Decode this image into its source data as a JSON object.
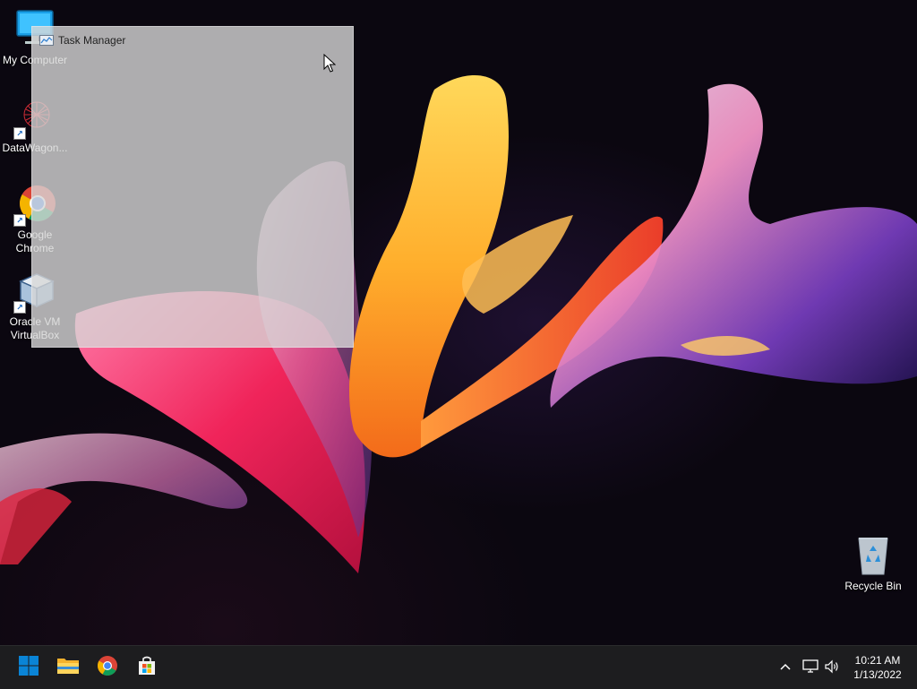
{
  "desktop": {
    "icons": [
      {
        "label": "My Computer",
        "icon": "monitor-icon"
      },
      {
        "label": "DataWagon...",
        "icon": "datawagon-icon"
      },
      {
        "label": "Google Chrome",
        "icon": "chrome-icon"
      },
      {
        "label": "Oracle VM VirtualBox",
        "icon": "virtualbox-icon"
      },
      {
        "label": "Recycle Bin",
        "icon": "recycle-bin-icon"
      }
    ]
  },
  "ghost_window": {
    "title": "Task Manager",
    "icon": "task-manager-icon"
  },
  "taskbar": {
    "pinned": [
      {
        "name": "Start",
        "icon": "windows-logo-icon"
      },
      {
        "name": "File Explorer",
        "icon": "folder-icon"
      },
      {
        "name": "Google Chrome",
        "icon": "chrome-icon"
      },
      {
        "name": "Microsoft Store",
        "icon": "store-icon"
      }
    ],
    "tray": {
      "icons": [
        "chevron-up-icon",
        "network-icon",
        "volume-icon"
      ],
      "time": "10:21 AM",
      "date": "1/13/2022"
    }
  },
  "colors": {
    "taskbar_bg": "#1d1d1f",
    "windows_blue": "#0a84d6",
    "ghost_window": "#d7d7d7"
  }
}
